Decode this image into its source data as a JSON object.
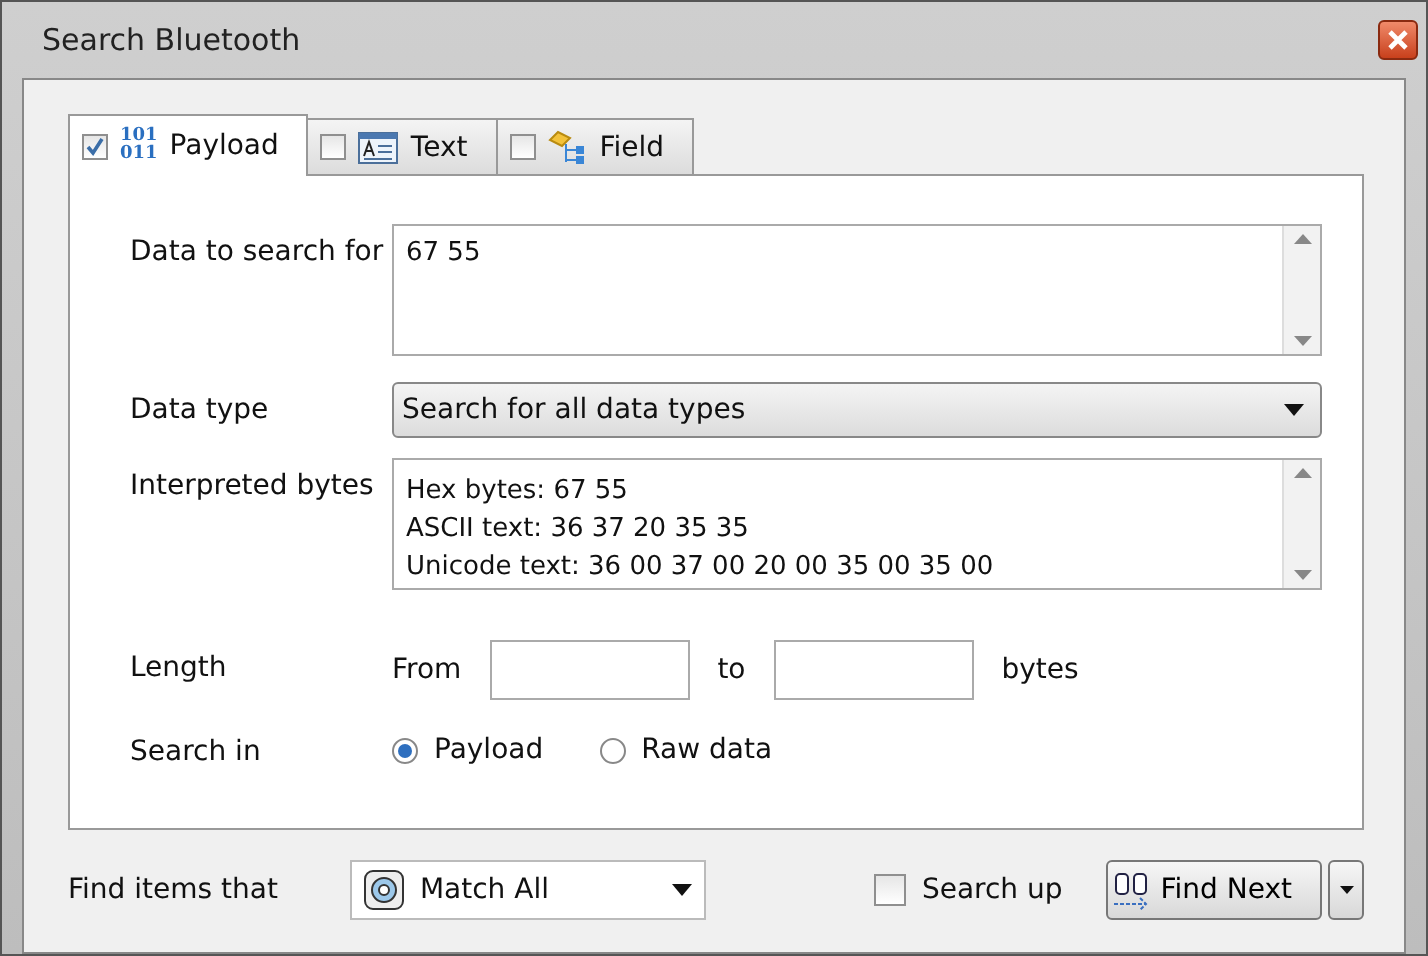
{
  "window": {
    "title": "Search Bluetooth"
  },
  "tabs": [
    {
      "kind": "payload",
      "label": "Payload",
      "checked": true,
      "selected": true,
      "icon_text": [
        "101",
        "011"
      ]
    },
    {
      "kind": "text",
      "label": "Text",
      "checked": false,
      "selected": false
    },
    {
      "kind": "field",
      "label": "Field",
      "checked": false,
      "selected": false
    }
  ],
  "data": {
    "label": "Data to search for",
    "value": "67 55"
  },
  "data_type": {
    "label": "Data type",
    "value": "Search for all data types"
  },
  "interpreted": {
    "label": "Interpreted bytes",
    "lines": [
      "Hex bytes: 67 55",
      "ASCII text: 36 37 20 35 35",
      "Unicode text: 36 00 37 00 20 00 35 00 35 00"
    ]
  },
  "length": {
    "label": "Length",
    "from": "From",
    "to": "to",
    "unit": "bytes"
  },
  "search_in": {
    "label": "Search in",
    "options": [
      {
        "label": "Payload",
        "selected": true
      },
      {
        "label": "Raw data",
        "selected": false
      }
    ]
  },
  "footer": {
    "find_label": "Find items that",
    "match": "Match All",
    "search_up": {
      "label": "Search up",
      "checked": false
    },
    "find_next": "Find Next"
  }
}
